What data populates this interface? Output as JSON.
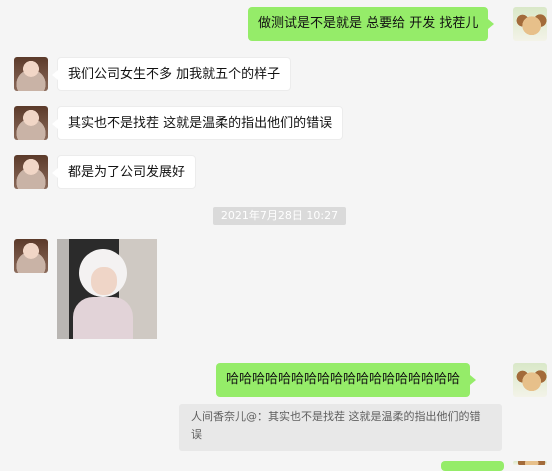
{
  "messages": [
    {
      "side": "right",
      "text": "做测试是不是就是 总要给 开发 找茬儿"
    },
    {
      "side": "left",
      "text": "我们公司女生不多  加我就五个的样子"
    },
    {
      "side": "left",
      "text": "其实也不是找茬  这就是温柔的指出他们的错误"
    },
    {
      "side": "left",
      "text": "都是为了公司发展好"
    },
    {
      "side": "center",
      "text": "2021年7月28日 10:27"
    },
    {
      "side": "left",
      "type": "image"
    },
    {
      "side": "right",
      "text": "哈哈哈哈哈哈哈哈哈哈哈哈哈哈哈哈哈哈"
    }
  ],
  "quote": {
    "text": "人间香奈儿@：其实也不是找茬  这就是温柔的指出他们的错误"
  },
  "colors": {
    "right_bubble": "#95ec69",
    "left_bubble": "#ffffff",
    "background": "#f5f5f5"
  }
}
